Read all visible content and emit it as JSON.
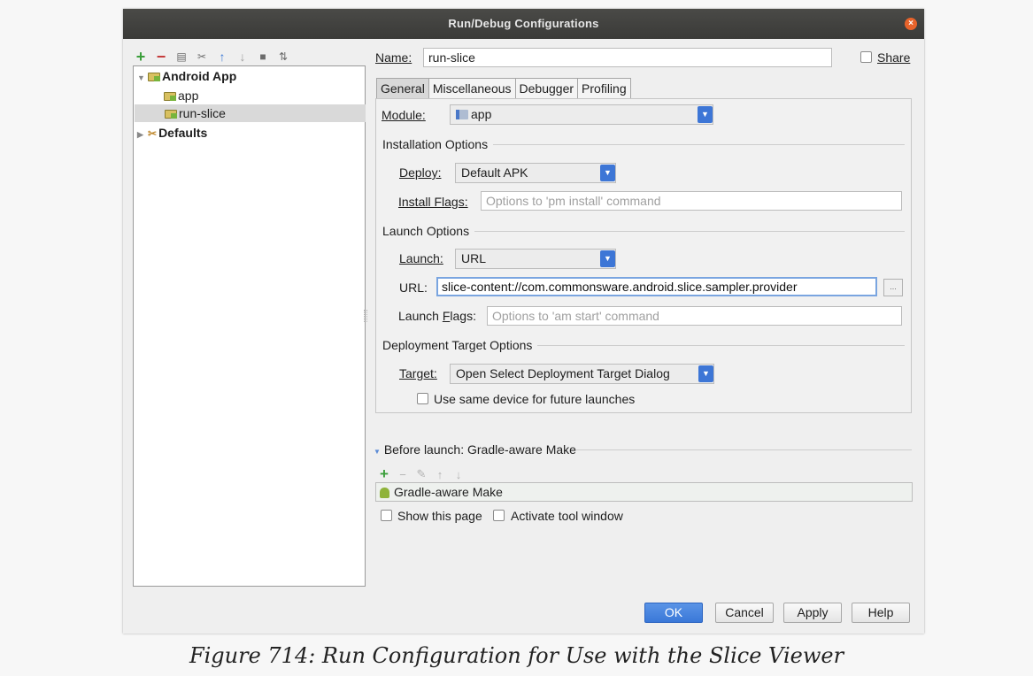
{
  "window": {
    "title": "Run/Debug Configurations"
  },
  "tree": {
    "android_app": "Android App",
    "app": "app",
    "run_slice": "run-slice",
    "defaults": "Defaults"
  },
  "name_label": "Name:",
  "name_value": "run-slice",
  "share_label": "Share",
  "tabs": [
    "General",
    "Miscellaneous",
    "Debugger",
    "Profiling"
  ],
  "general": {
    "module_label": "Module:",
    "module_value": "app",
    "installation_options": "Installation Options",
    "deploy_label": "Deploy:",
    "deploy_value": "Default APK",
    "install_flags_label": "Install Flags:",
    "install_flags_placeholder": "Options to 'pm install' command",
    "launch_options": "Launch Options",
    "launch_label": "Launch:",
    "launch_value": "URL",
    "url_label": "URL:",
    "url_value": "slice-content://com.commonsware.android.slice.sampler.provider",
    "browse_label": "...",
    "launch_flags_label": "Launch Flags:",
    "launch_flags_placeholder": "Options to 'am start' command",
    "deployment_target_options": "Deployment Target Options",
    "target_label": "Target:",
    "target_value": "Open Select Deployment Target Dialog",
    "same_device_label": "Use same device for future launches"
  },
  "before_launch": {
    "title": "Before launch: Gradle-aware Make",
    "items": [
      "Gradle-aware Make"
    ],
    "show_page_label": "Show this page",
    "activate_tool_label": "Activate tool window"
  },
  "buttons": {
    "ok": "OK",
    "cancel": "Cancel",
    "apply": "Apply",
    "help": "Help"
  },
  "caption": "Figure 714: Run Configuration for Use with the Slice Viewer"
}
